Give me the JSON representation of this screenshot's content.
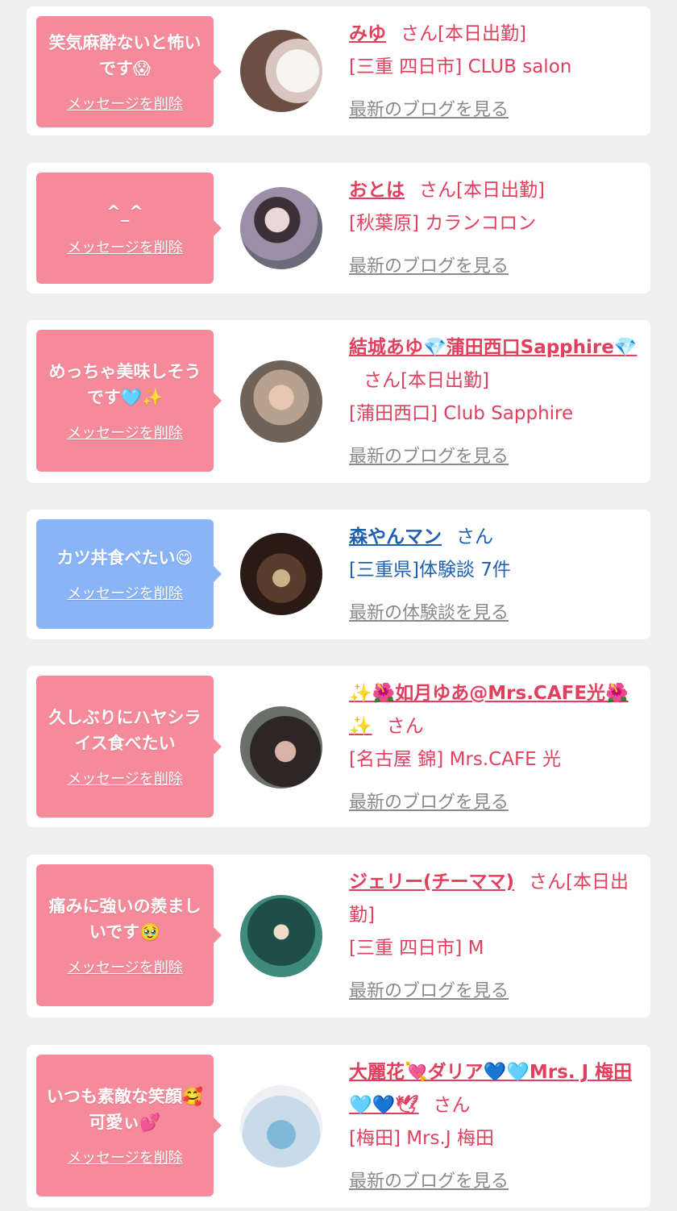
{
  "colors": {
    "pink_bubble": "#f58a9b",
    "blue_bubble": "#8ab4f8",
    "pink_text": "#e0405e",
    "blue_text": "#1f60b0",
    "muted_link": "#8a8a8a",
    "background": "#efefef"
  },
  "delete_label": "メッセージを削除",
  "cards": [
    {
      "message": "笑気麻酔ないと怖いです😱",
      "name": "みゆ",
      "suffix": "さん[本日出勤]",
      "shop": "[三重 四日市] CLUB salon",
      "blog": "最新のブログを見る",
      "theme": "pink"
    },
    {
      "message": "^_^",
      "name": "おとは",
      "suffix": "さん[本日出勤]",
      "shop": "[秋葉原] カランコロン",
      "blog": "最新のブログを見る",
      "theme": "pink"
    },
    {
      "message": "めっちゃ美味しそうです🩵✨",
      "name": "結城あゆ💎蒲田西口Sapphire💎",
      "suffix": "さん[本日出勤]",
      "shop": "[蒲田西口] Club Sapphire",
      "blog": "最新のブログを見る",
      "theme": "pink"
    },
    {
      "message": "カツ丼食べたい😋",
      "name": "森やんマン",
      "suffix": "さん",
      "shop": "[三重県]体験談 7件",
      "blog": "最新の体験談を見る",
      "theme": "blue"
    },
    {
      "message": "久しぶりにハヤシライス食べたい",
      "name": "✨🌺如月ゆあ@Mrs.CAFE光🌺✨",
      "suffix": "さん",
      "shop": "[名古屋 錦] Mrs.CAFE 光",
      "blog": "最新のブログを見る",
      "theme": "pink"
    },
    {
      "message": "痛みに強いの羨ましいです🥹",
      "name": "ジェリー(チーママ)",
      "suffix": "さん[本日出勤]",
      "shop": "[三重 四日市] M",
      "blog": "最新のブログを見る",
      "theme": "pink"
    },
    {
      "message": "いつも素敵な笑顔🥰可愛ぃ💕",
      "name": "大麗花💘ダリア💙🩵Mrs. J 梅田🩵💙🕊",
      "suffix": "さん",
      "shop": "[梅田] Mrs.J 梅田",
      "blog": "最新のブログを見る",
      "theme": "pink"
    }
  ]
}
